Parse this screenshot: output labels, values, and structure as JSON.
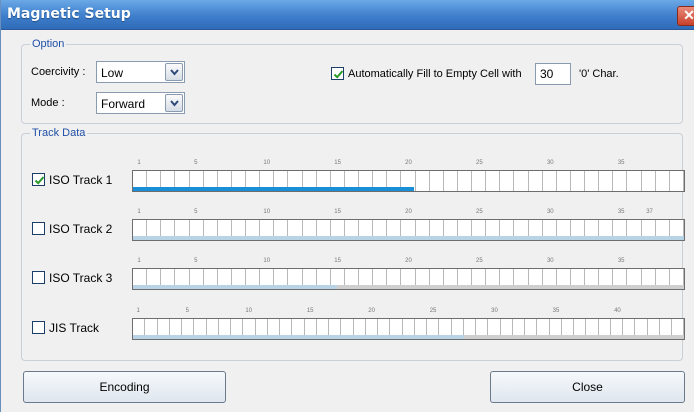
{
  "window": {
    "title": "Magnetic Setup",
    "close_glyph": "✕"
  },
  "option": {
    "legend": "Option",
    "coercivity_label": "Coercivity :",
    "coercivity_value": "Low",
    "mode_label": "Mode :",
    "mode_value": "Forward",
    "autofill_checked": true,
    "autofill_label": "Automatically Fill to Empty Cell with",
    "autofill_value": "30",
    "autofill_suffix": "'0'  Char."
  },
  "track_data": {
    "legend": "Track Data",
    "tracks": [
      {
        "label": "ISO Track 1",
        "checked": true,
        "cells": 39,
        "filled_fraction": 0.51,
        "active": true,
        "ticks": [
          {
            "n": "1",
            "c": 1
          },
          {
            "n": "5",
            "c": 5
          },
          {
            "n": "10",
            "c": 10
          },
          {
            "n": "15",
            "c": 15
          },
          {
            "n": "20",
            "c": 20
          },
          {
            "n": "25",
            "c": 25
          },
          {
            "n": "30",
            "c": 30
          },
          {
            "n": "35",
            "c": 35
          }
        ]
      },
      {
        "label": "ISO Track 2",
        "checked": false,
        "cells": 39,
        "filled_fraction": 1.0,
        "active": false,
        "ticks": [
          {
            "n": "1",
            "c": 1
          },
          {
            "n": "5",
            "c": 5
          },
          {
            "n": "10",
            "c": 10
          },
          {
            "n": "15",
            "c": 15
          },
          {
            "n": "20",
            "c": 20
          },
          {
            "n": "25",
            "c": 25
          },
          {
            "n": "30",
            "c": 30
          },
          {
            "n": "35",
            "c": 35
          },
          {
            "n": "37",
            "c": 37
          }
        ]
      },
      {
        "label": "ISO Track 3",
        "checked": false,
        "cells": 39,
        "filled_fraction": 0.37,
        "active": false,
        "ticks": [
          {
            "n": "1",
            "c": 1
          },
          {
            "n": "5",
            "c": 5
          },
          {
            "n": "10",
            "c": 10
          },
          {
            "n": "15",
            "c": 15
          },
          {
            "n": "20",
            "c": 20
          },
          {
            "n": "25",
            "c": 25
          },
          {
            "n": "30",
            "c": 30
          },
          {
            "n": "35",
            "c": 35
          }
        ]
      },
      {
        "label": "JIS Track",
        "checked": false,
        "cells": 45,
        "filled_fraction": 0.6,
        "active": false,
        "ticks": [
          {
            "n": "1",
            "c": 1
          },
          {
            "n": "5",
            "c": 5
          },
          {
            "n": "10",
            "c": 10
          },
          {
            "n": "15",
            "c": 15
          },
          {
            "n": "20",
            "c": 20
          },
          {
            "n": "25",
            "c": 25
          },
          {
            "n": "30",
            "c": 30
          },
          {
            "n": "35",
            "c": 35
          },
          {
            "n": "40",
            "c": 40
          }
        ]
      }
    ]
  },
  "buttons": {
    "encoding": "Encoding",
    "close": "Close"
  },
  "colors": {
    "accent": "#1f4fa8",
    "progress_active": "#1a8fd8",
    "progress_inactive": "#b9d3e6",
    "progress_dim": "#cfcfcf"
  }
}
